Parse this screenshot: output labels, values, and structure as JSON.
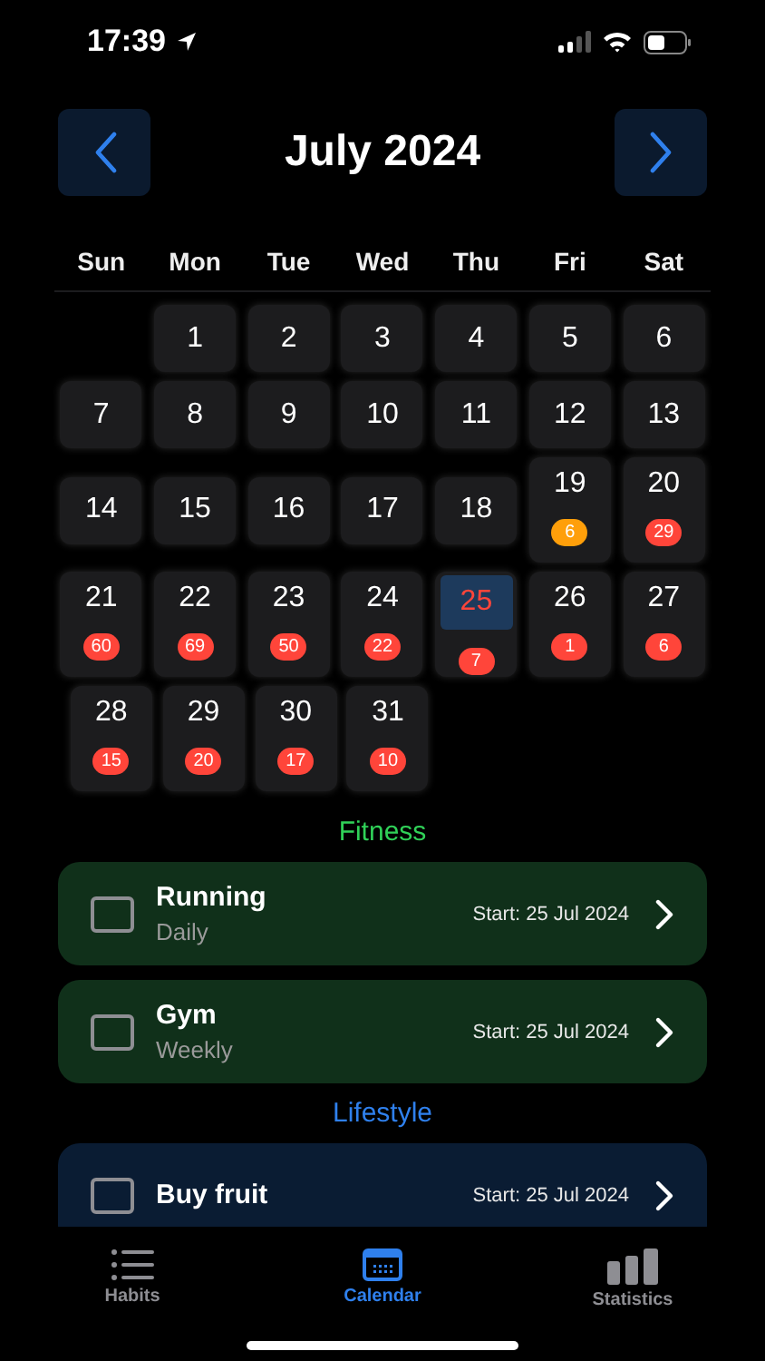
{
  "status_bar": {
    "time": "17:39"
  },
  "header": {
    "title": "July 2024"
  },
  "weekdays": [
    "Sun",
    "Mon",
    "Tue",
    "Wed",
    "Thu",
    "Fri",
    "Sat"
  ],
  "weeks": [
    {
      "days": [
        {
          "day": "1",
          "selected": false
        },
        {
          "day": "2",
          "selected": false
        },
        {
          "day": "3",
          "selected": false
        },
        {
          "day": "4",
          "selected": false
        },
        {
          "day": "5",
          "selected": false
        },
        {
          "day": "6",
          "selected": false
        }
      ]
    },
    {
      "days": [
        {
          "day": "7",
          "selected": false
        },
        {
          "day": "8",
          "selected": false
        },
        {
          "day": "9",
          "selected": false
        },
        {
          "day": "10",
          "selected": false
        },
        {
          "day": "11",
          "selected": false
        },
        {
          "day": "12",
          "selected": false
        },
        {
          "day": "13",
          "selected": false
        }
      ]
    },
    {
      "days": [
        {
          "day": "14",
          "selected": false
        },
        {
          "day": "15",
          "selected": false
        },
        {
          "day": "16",
          "selected": false
        },
        {
          "day": "17",
          "selected": false
        },
        {
          "day": "18",
          "selected": false
        },
        {
          "day": "19",
          "selected": false,
          "count": "6",
          "color": "#ff9f0a"
        },
        {
          "day": "20",
          "selected": false,
          "count": "29",
          "color": "#ff453a"
        }
      ]
    },
    {
      "days": [
        {
          "day": "21",
          "selected": false,
          "count": "60",
          "color": "#ff453a"
        },
        {
          "day": "22",
          "selected": false,
          "count": "69",
          "color": "#ff453a"
        },
        {
          "day": "23",
          "selected": false,
          "count": "50",
          "color": "#ff453a"
        },
        {
          "day": "24",
          "selected": false,
          "count": "22",
          "color": "#ff453a"
        },
        {
          "day": "25",
          "selected": true,
          "count": "7",
          "color": "#ff453a"
        },
        {
          "day": "26",
          "selected": false,
          "count": "1",
          "color": "#ff453a"
        },
        {
          "day": "27",
          "selected": false,
          "count": "6",
          "color": "#ff453a"
        }
      ]
    },
    {
      "days": [
        {
          "day": "28",
          "selected": false,
          "count": "15",
          "color": "#ff453a"
        },
        {
          "day": "29",
          "selected": false,
          "count": "20",
          "color": "#ff453a"
        },
        {
          "day": "30",
          "selected": false,
          "count": "17",
          "color": "#ff453a"
        },
        {
          "day": "31",
          "selected": false,
          "count": "10",
          "color": "#ff453a"
        }
      ]
    }
  ],
  "groups": [
    {
      "title": "Fitness",
      "color": "#30d158",
      "habits": [
        {
          "name": "Running",
          "frequency": "Daily",
          "start": "Start: 25 Jul 2024",
          "checked": false
        },
        {
          "name": "Gym",
          "frequency": "Weekly",
          "start": "Start: 25 Jul 2024",
          "checked": false
        }
      ]
    },
    {
      "title": "Lifestyle",
      "color": "#2f80ed",
      "habits": [
        {
          "name": "Buy fruit",
          "start": "Start: 25 Jul 2024",
          "checked": false
        }
      ]
    }
  ],
  "tabs": [
    {
      "label": "Habits",
      "kind": "list",
      "selected": false
    },
    {
      "label": "Calendar",
      "kind": "calendar",
      "selected": true
    },
    {
      "label": "Statistics",
      "kind": "chart",
      "selected": false
    }
  ]
}
